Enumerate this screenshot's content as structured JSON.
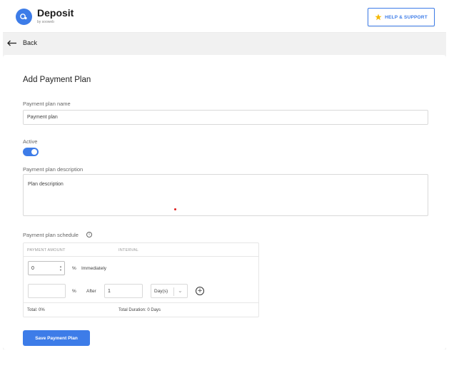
{
  "header": {
    "app_name": "Deposit",
    "app_sub": "by sooweb",
    "help_label": "HELP & SUPPORT",
    "help_icon": "star-icon",
    "colors": {
      "accent": "#3d7ce8",
      "star": "#f5b800"
    }
  },
  "nav": {
    "back_label": "Back",
    "back_icon": "arrow-left-icon"
  },
  "form": {
    "title": "Add Payment Plan",
    "name_label": "Payment plan name",
    "name_value": "Payment plan",
    "active_label": "Active",
    "active_on": true,
    "description_label": "Payment plan description",
    "description_value": "Plan description",
    "schedule_label": "Payment plan schedule",
    "schedule": {
      "headers": [
        "PAYMENT AMOUNT",
        "INTERVAL"
      ],
      "row1": {
        "amount": "0",
        "unit": "%",
        "interval_text": "Immediately"
      },
      "row2": {
        "amount": "",
        "unit": "%",
        "after_label": "After",
        "after_value": "1",
        "interval_unit": "Day(s)"
      },
      "total_label": "Total: 0%",
      "duration_label": "Total Duration: 0 Days"
    },
    "save_label": "Save Payment Plan"
  }
}
